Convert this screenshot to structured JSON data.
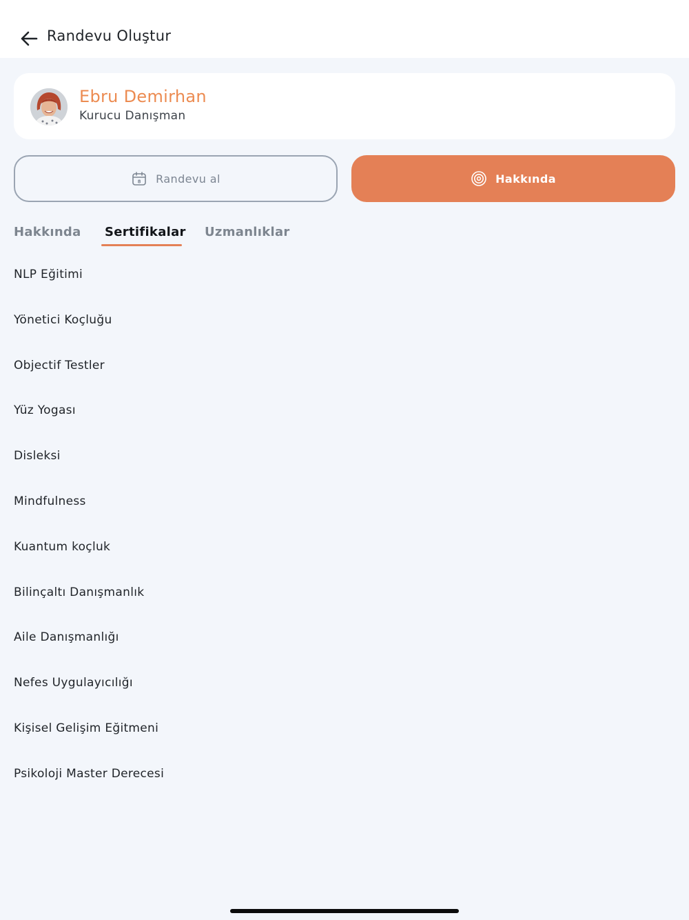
{
  "header": {
    "title": "Randevu Oluştur",
    "back_icon": "arrow-left-icon"
  },
  "profile": {
    "name": "Ebru Demirhan",
    "role": "Kurucu Danışman",
    "name_color": "#ec8b51"
  },
  "actions": {
    "appointment_label": "Randevu al",
    "appointment_icon": "calendar-icon",
    "about_label": "Hakkında",
    "about_icon": "target-icon",
    "accent_color": "#e48056"
  },
  "tabs": [
    {
      "label": "Hakkında",
      "active": false
    },
    {
      "label": "Sertifikalar",
      "active": true
    },
    {
      "label": "Uzmanlıklar",
      "active": false
    }
  ],
  "certificates": [
    "NLP Eğitimi",
    "Yönetici Koçluğu",
    "Objectif Testler",
    "Yüz Yogası",
    "Disleksi",
    "Mindfulness",
    "Kuantum koçluk",
    "Bilinçaltı Danışmanlık",
    "Aile Danışmanlığı",
    "Nefes Uygulayıcılığı",
    "Kişisel Gelişim Eğitmeni",
    "Psikoloji Master Derecesi"
  ]
}
